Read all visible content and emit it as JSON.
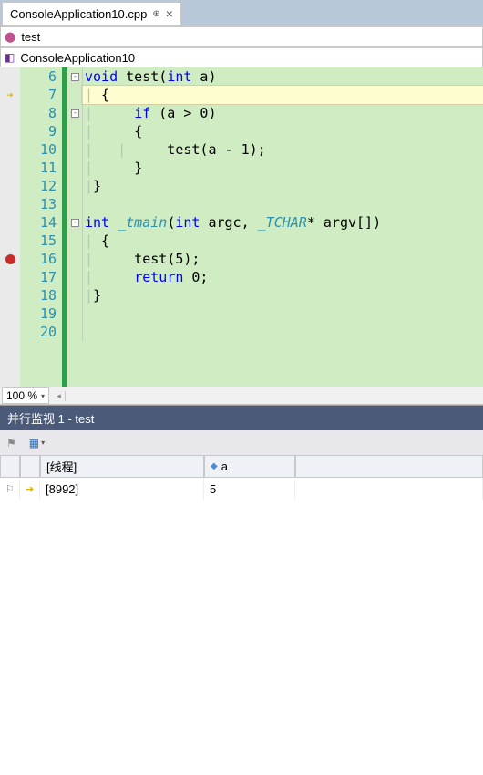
{
  "tab": {
    "filename": "ConsoleApplication10.cpp"
  },
  "scope_dropdown": {
    "function_label": "test",
    "class_label": "ConsoleApplication10"
  },
  "editor": {
    "zoom": "100 %",
    "lines": [
      {
        "n": 6,
        "fold": "⊟",
        "html": "<span class='kw'>void</span> test(<span class='kw'>int</span> a)"
      },
      {
        "n": 7,
        "html": "<span class='guide'>|</span> {",
        "highlight": true,
        "marker": "arrow"
      },
      {
        "n": 8,
        "fold": "⊟",
        "html": "<span class='guide'>|</span>     <span class='kw'>if</span> (a &gt; 0)"
      },
      {
        "n": 9,
        "html": "<span class='guide'>|</span>     {"
      },
      {
        "n": 10,
        "html": "<span class='guide'>|</span>   <span class='guide'>|</span>     test(a - 1);"
      },
      {
        "n": 11,
        "html": "<span class='guide'>|</span>     }"
      },
      {
        "n": 12,
        "html": "<span class='guide'>|</span>}"
      },
      {
        "n": 13,
        "html": ""
      },
      {
        "n": 14,
        "fold": "⊟",
        "html": "<span class='kw'>int</span> <span class='typ'>_tmain</span>(<span class='kw'>int</span> argc, <span class='typ'>_TCHAR</span>* argv[])"
      },
      {
        "n": 15,
        "html": "<span class='guide'>|</span> {"
      },
      {
        "n": 16,
        "html": "<span class='guide'>|</span>     test(5);",
        "marker": "breakpoint"
      },
      {
        "n": 17,
        "html": "<span class='guide'>|</span>     <span class='kw'>return</span> 0;"
      },
      {
        "n": 18,
        "html": "<span class='guide'>|</span>}"
      },
      {
        "n": 19,
        "html": ""
      },
      {
        "n": 20,
        "html": ""
      }
    ]
  },
  "watch": {
    "title": "并行监视 1 - test",
    "headers": {
      "thread": "[线程]",
      "var1": "a"
    },
    "rows": [
      {
        "thread": "[8992]",
        "var1": "5",
        "current": true
      }
    ]
  }
}
